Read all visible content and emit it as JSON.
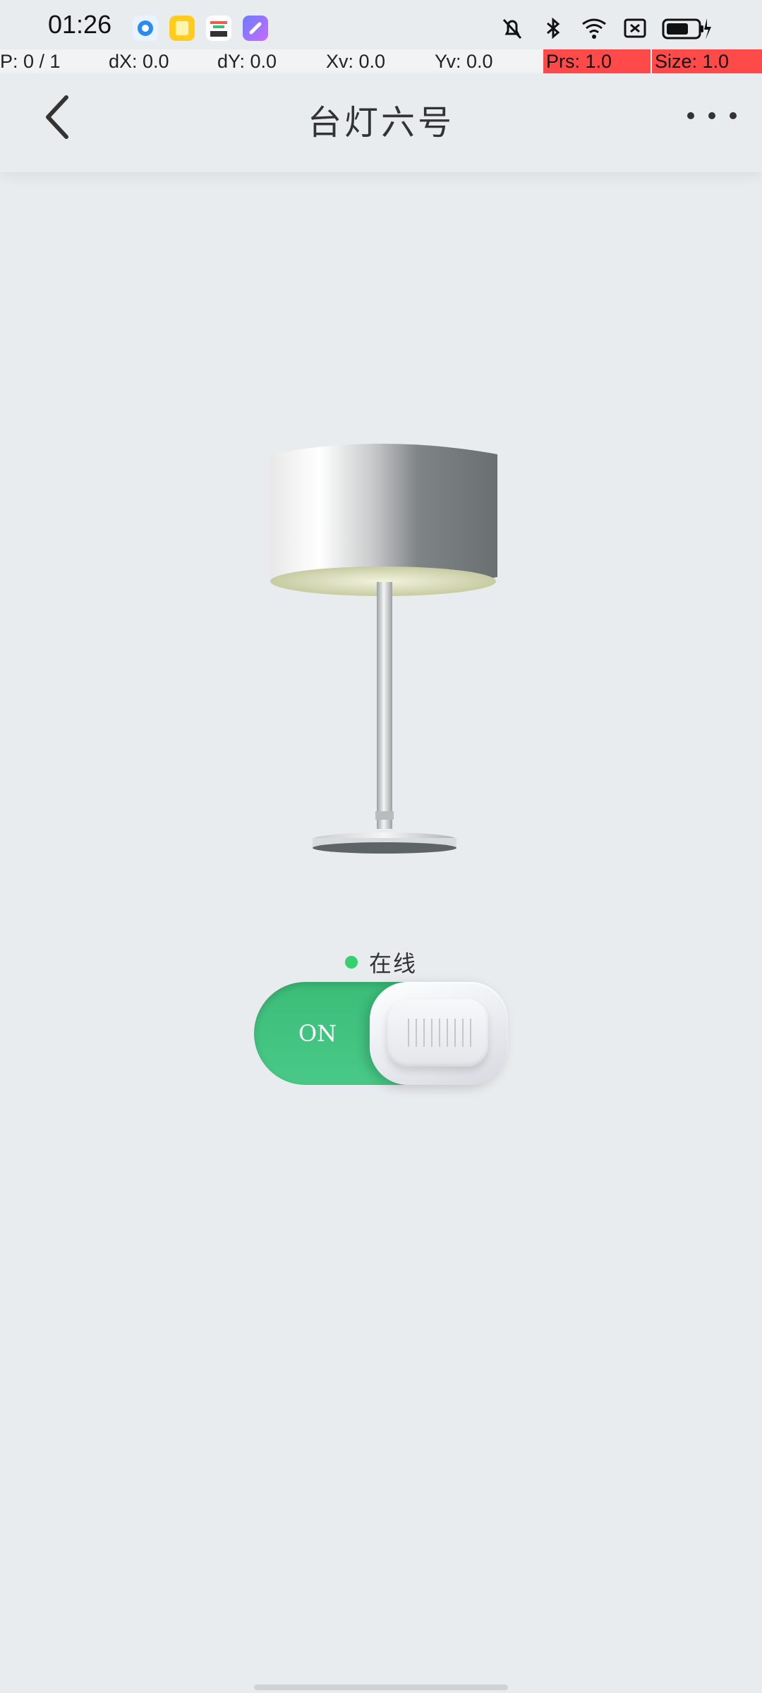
{
  "status_bar": {
    "time": "01:26",
    "icons": [
      "alarm-off-icon",
      "bluetooth-icon",
      "wifi-icon",
      "sim-off-icon",
      "battery-charging-icon"
    ],
    "app_icons": [
      "browser-app-icon",
      "notes-app-icon",
      "store-app-icon",
      "assistant-app-icon"
    ]
  },
  "debug": {
    "p": "P: 0 / 1",
    "dx": "dX: 0.0",
    "dy": "dY: 0.0",
    "xv": "Xv: 0.0",
    "yv": "Yv: 0.0",
    "prs": "Prs: 1.0",
    "size": "Size: 1.0"
  },
  "header": {
    "title": "台灯六号",
    "back_icon": "chevron-left-icon",
    "more_icon": "more-horizontal-icon"
  },
  "device": {
    "status": "在线",
    "switch_label": "ON",
    "switch_on": true
  },
  "colors": {
    "background": "#e9ecef",
    "switch_green": "#45c482",
    "online_green": "#36d06c",
    "debug_red": "#ff4a4a"
  }
}
